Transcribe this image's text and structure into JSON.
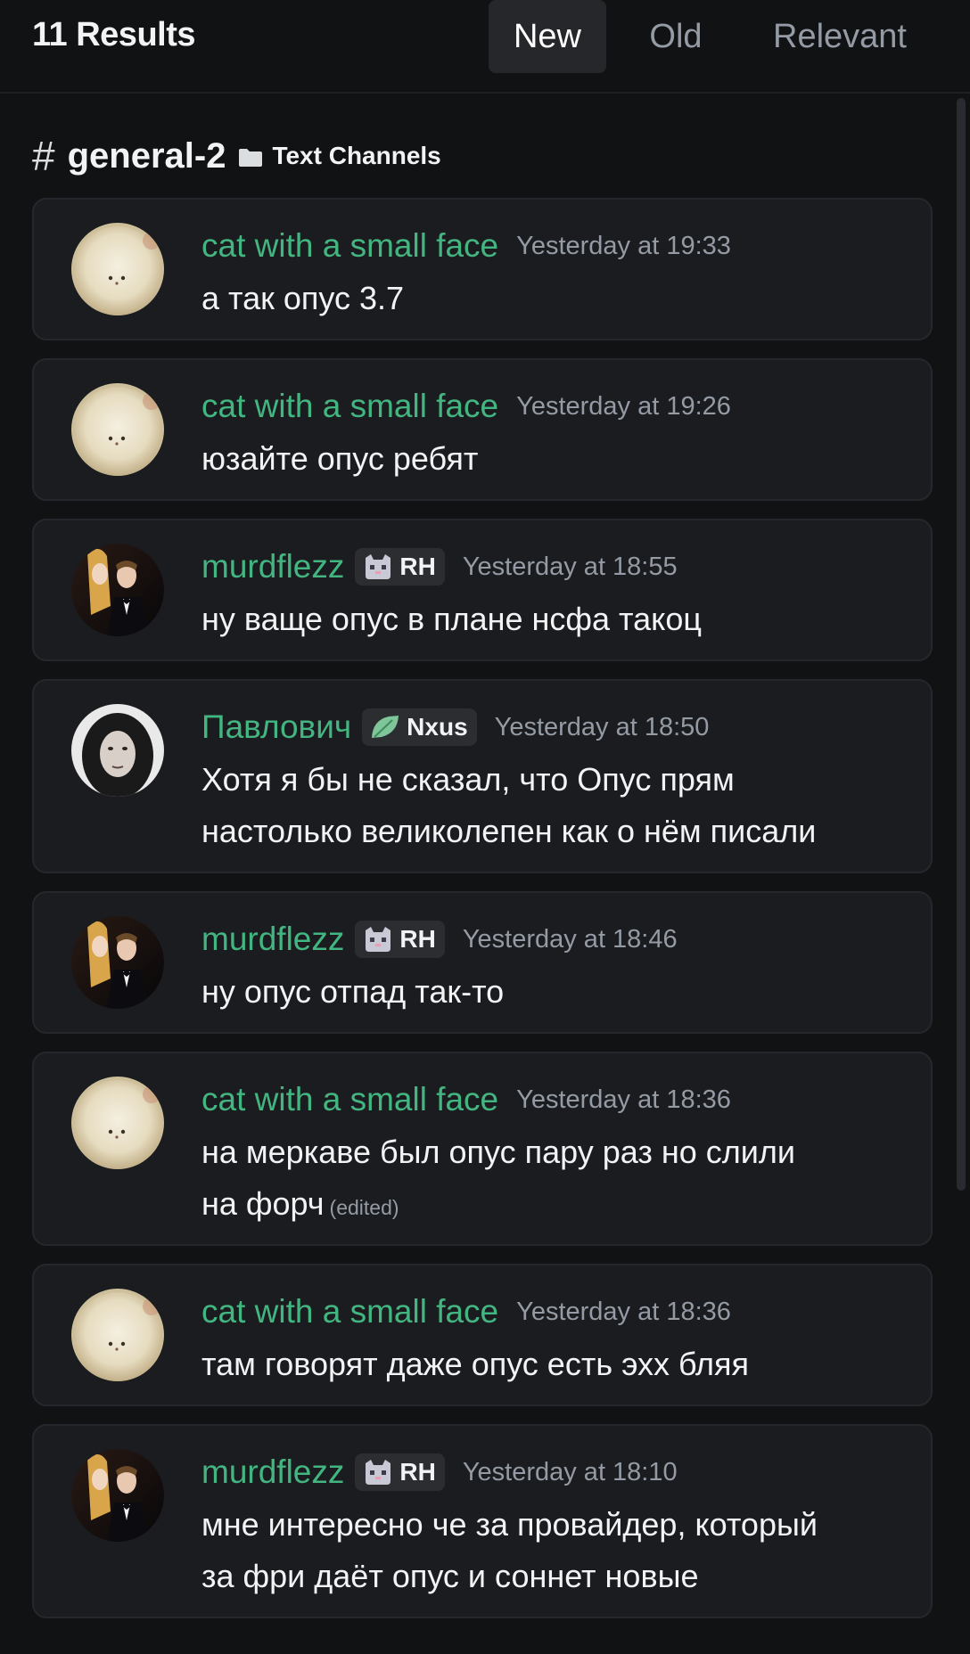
{
  "header": {
    "results_count": "11 Results",
    "sort_tabs": [
      {
        "label": "New",
        "active": true
      },
      {
        "label": "Old",
        "active": false
      },
      {
        "label": "Relevant",
        "active": false
      }
    ]
  },
  "channel": {
    "hash": "#",
    "name": "general-2",
    "category": "Text Channels",
    "category_icon": "folder-icon"
  },
  "colors": {
    "author": "#43b581",
    "background": "#111214",
    "card": "#1b1c1f"
  },
  "messages": [
    {
      "author": "cat with a small face",
      "avatar": "cat-avatar",
      "tag": "",
      "time": "Yesterday at 19:33",
      "lines": [
        "а так опус 3.7"
      ],
      "edited": ""
    },
    {
      "author": "cat with a small face",
      "avatar": "cat-avatar",
      "tag": "",
      "time": "Yesterday at 19:26",
      "lines": [
        "юзайте опус ребят"
      ],
      "edited": ""
    },
    {
      "author": "murdflezz",
      "avatar": "murdflezz-avatar",
      "tag": "RH",
      "tag_icon": "cat-badge-icon",
      "time": "Yesterday at 18:55",
      "lines": [
        "ну ваще опус в плане нсфа такоц"
      ],
      "edited": ""
    },
    {
      "author": "Павлович",
      "avatar": "pavlovich-avatar",
      "tag": "Nxus",
      "tag_icon": "leaf-badge-icon",
      "time": "Yesterday at 18:50",
      "lines": [
        "Хотя я бы не сказал, что Опус прям",
        "настолько великолепен как о нём писали"
      ],
      "edited": ""
    },
    {
      "author": "murdflezz",
      "avatar": "murdflezz-avatar",
      "tag": "RH",
      "tag_icon": "cat-badge-icon",
      "time": "Yesterday at 18:46",
      "lines": [
        "ну опус отпад так-то"
      ],
      "edited": ""
    },
    {
      "author": "cat with a small face",
      "avatar": "cat-avatar",
      "tag": "",
      "time": "Yesterday at 18:36",
      "lines": [
        "на меркаве был опус пару раз но слили",
        "на форч"
      ],
      "edited": "(edited)"
    },
    {
      "author": "cat with a small face",
      "avatar": "cat-avatar",
      "tag": "",
      "time": "Yesterday at 18:36",
      "lines": [
        "там говорят даже опус есть эхх бляя"
      ],
      "edited": ""
    },
    {
      "author": "murdflezz",
      "avatar": "murdflezz-avatar",
      "tag": "RH",
      "tag_icon": "cat-badge-icon",
      "time": "Yesterday at 18:10",
      "lines": [
        "мне интересно че за провайдер, который",
        "за фри даёт опус и соннет новые"
      ],
      "edited": ""
    }
  ]
}
